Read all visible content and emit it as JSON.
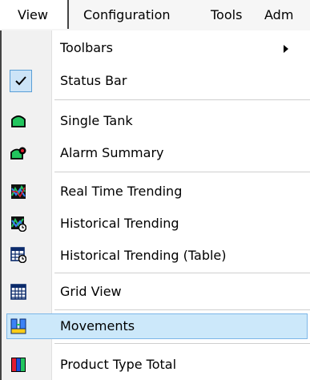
{
  "menubar": {
    "items": [
      "View",
      "Configuration",
      "Tools",
      "Adm"
    ]
  },
  "view_menu": {
    "items": [
      {
        "label": "Toolbars",
        "icon": "submenu-arrow-icon"
      },
      {
        "label": "Status Bar",
        "icon": "checkmark-icon",
        "checked": true
      },
      {
        "label": "Single Tank",
        "icon": "tank-icon"
      },
      {
        "label": "Alarm Summary",
        "icon": "alarm-tank-icon"
      },
      {
        "label": "Real Time Trending",
        "icon": "trend-chart-icon"
      },
      {
        "label": "Historical Trending",
        "icon": "historical-trend-icon"
      },
      {
        "label": "Historical Trending (Table)",
        "icon": "table-trend-icon"
      },
      {
        "label": "Grid View",
        "icon": "grid-icon"
      },
      {
        "label": "Movements",
        "icon": "movements-icon",
        "highlighted": true
      },
      {
        "label": "Product Type Total",
        "icon": "product-total-icon"
      }
    ]
  },
  "colors": {
    "highlight_bg": "#cce8fa",
    "highlight_border": "#7db7e8",
    "tank_green": "#22c55e"
  }
}
